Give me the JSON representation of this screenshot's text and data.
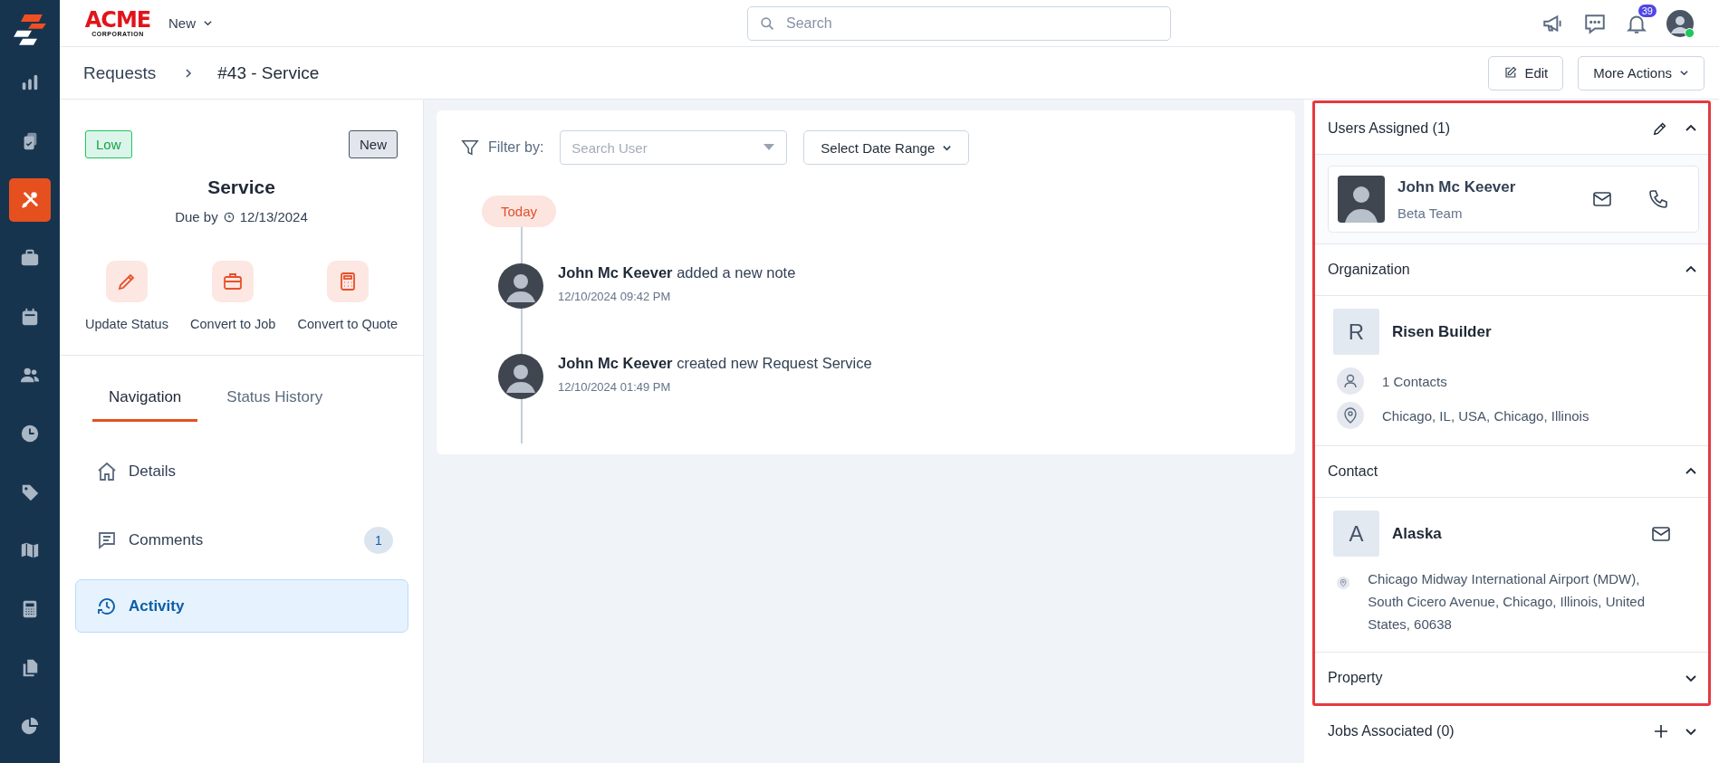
{
  "header": {
    "logo_title": "ACME",
    "logo_subtitle": "CORPORATION",
    "new_menu": "New",
    "search": {
      "placeholder": "Search"
    },
    "notification_count": "39",
    "user_online": true
  },
  "sidebar": {
    "items": [
      {
        "selected": false
      },
      {
        "selected": false
      },
      {
        "selected": true
      },
      {
        "selected": false
      },
      {
        "selected": false
      },
      {
        "selected": false
      },
      {
        "selected": false
      },
      {
        "selected": false
      },
      {
        "selected": false
      },
      {
        "selected": false
      },
      {
        "selected": false
      },
      {
        "selected": false
      }
    ]
  },
  "breadcrumb": {
    "parent": "Requests",
    "current": "#43 - Service"
  },
  "actions": {
    "edit": "Edit",
    "more": "More Actions"
  },
  "request": {
    "priority": "Low",
    "status": "New",
    "title": "Service",
    "due_label": "Due by",
    "due_date": "12/13/2024",
    "quick_actions": [
      "Update Status",
      "Convert to Job",
      "Convert to Quote"
    ]
  },
  "tabs": [
    {
      "label": "Navigation",
      "selected": true
    },
    {
      "label": "Status History",
      "selected": false
    }
  ],
  "nav_items": [
    {
      "label": "Details",
      "selected": false
    },
    {
      "label": "Comments",
      "badge": "1",
      "selected": false
    },
    {
      "label": "Activity",
      "selected": true
    }
  ],
  "activity": {
    "filter_label": "Filter by:",
    "user_select": {
      "placeholder": "Search User"
    },
    "date_range": "Select Date Range",
    "day_label": "Today",
    "entries": [
      {
        "text": "**John Mc Keever** added a new note",
        "time": "12/10/2024 09:42 PM"
      },
      {
        "text": "**John Mc Keever** created new Request Service",
        "time": "12/10/2024 01:49 PM"
      }
    ]
  },
  "right_panel": {
    "highlighted_sections": [
      {
        "kind": "users",
        "title": "Users Assigned (1)",
        "expanded": true,
        "users": [
          {
            "name": "John Mc Keever",
            "team": "Beta Team"
          }
        ]
      },
      {
        "kind": "organization",
        "title": "Organization",
        "expanded": true,
        "initial": "R",
        "name": "Risen Builder",
        "contacts": "1 Contacts",
        "location": "Chicago, IL, USA, Chicago, Illinois"
      },
      {
        "kind": "contact",
        "title": "Contact",
        "expanded": true,
        "initial": "A",
        "name": "Alaska",
        "address": "Chicago Midway International Airport (MDW), South Cicero Avenue, Chicago, Illinois, United States, 60638"
      },
      {
        "kind": "property",
        "title": "Property",
        "expanded": false
      }
    ],
    "other_sections": [
      {
        "kind": "jobs",
        "title": "Jobs Associated (0)",
        "expanded": false
      }
    ]
  }
}
